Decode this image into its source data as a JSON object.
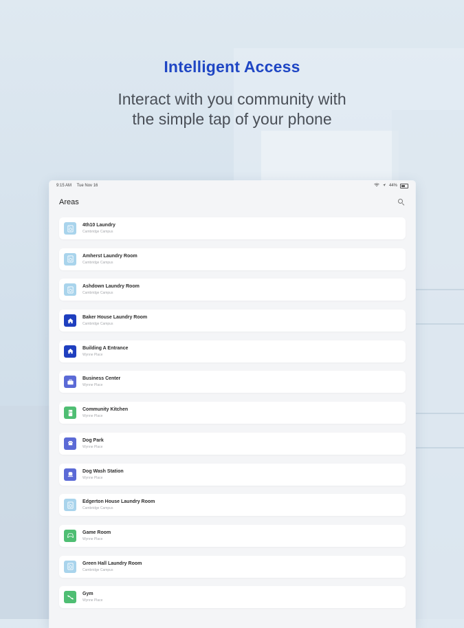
{
  "hero": {
    "title": "Intelligent Access",
    "subtitle_line1": "Interact with you community with",
    "subtitle_line2": "the simple tap of your phone"
  },
  "status_bar": {
    "time": "9:15 AM",
    "date": "Tue Nov 16",
    "battery": "44%"
  },
  "header": {
    "title": "Areas"
  },
  "colors": {
    "accent_blue": "#1f46c4",
    "laundry_icon_bg": "#a9d4ec",
    "home_icon_bg": "#1f3fbf",
    "indigo_icon_bg": "#5b6ad6",
    "green_icon_bg": "#4fbe73"
  },
  "areas": [
    {
      "name": "4th10 Laundry",
      "location": "Cambridge Campus",
      "icon": "washing-machine-icon",
      "color": "#a9d4ec"
    },
    {
      "name": "Amherst Laundry Room",
      "location": "Cambridge Campus",
      "icon": "washing-machine-icon",
      "color": "#a9d4ec"
    },
    {
      "name": "Ashdown Laundry Room",
      "location": "Cambridge Campus",
      "icon": "washing-machine-icon",
      "color": "#a9d4ec"
    },
    {
      "name": "Baker House Laundry Room",
      "location": "Cambridge Campus",
      "icon": "home-icon",
      "color": "#1f3fbf"
    },
    {
      "name": "Building A Entrance",
      "location": "Wynne Place",
      "icon": "home-icon",
      "color": "#1f3fbf"
    },
    {
      "name": "Business Center",
      "location": "Wynne Place",
      "icon": "briefcase-icon",
      "color": "#5b6ad6"
    },
    {
      "name": "Community Kitchen",
      "location": "Wynne Place",
      "icon": "kitchen-icon",
      "color": "#4fbe73"
    },
    {
      "name": "Dog Park",
      "location": "Wynne Place",
      "icon": "dog-icon",
      "color": "#5b6ad6"
    },
    {
      "name": "Dog Wash Station",
      "location": "Wynne Place",
      "icon": "dog-wash-icon",
      "color": "#5b6ad6"
    },
    {
      "name": "Edgerton House Laundry Room",
      "location": "Cambridge Campus",
      "icon": "washing-machine-icon",
      "color": "#a9d4ec"
    },
    {
      "name": "Game Room",
      "location": "Wynne Place",
      "icon": "game-controller-icon",
      "color": "#4fbe73"
    },
    {
      "name": "Green Hall Laundry Room",
      "location": "Cambridge Campus",
      "icon": "washing-machine-icon",
      "color": "#a9d4ec"
    },
    {
      "name": "Gym",
      "location": "Wynne Place",
      "icon": "dumbbell-icon",
      "color": "#4fbe73"
    }
  ]
}
